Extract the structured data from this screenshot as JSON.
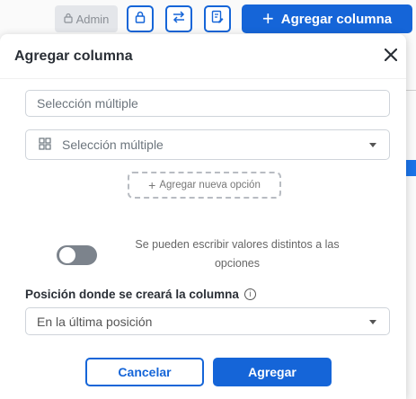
{
  "toolbar": {
    "admin_label": "Admin",
    "add_column_label": "Agregar columna"
  },
  "modal": {
    "title": "Agregar columna",
    "name_placeholder": "Selección múltiple",
    "type_selected": "Selección múltiple",
    "add_option_label": "Agregar nueva opción",
    "toggle_text": "Se pueden escribir valores distintos a las opciones",
    "toggle_on": false,
    "position_label": "Posición donde se creará la columna",
    "position_selected": "En la última posición",
    "cancel_label": "Cancelar",
    "submit_label": "Agregar"
  },
  "colors": {
    "primary": "#1565d8",
    "toggle_off": "#7c838c"
  }
}
